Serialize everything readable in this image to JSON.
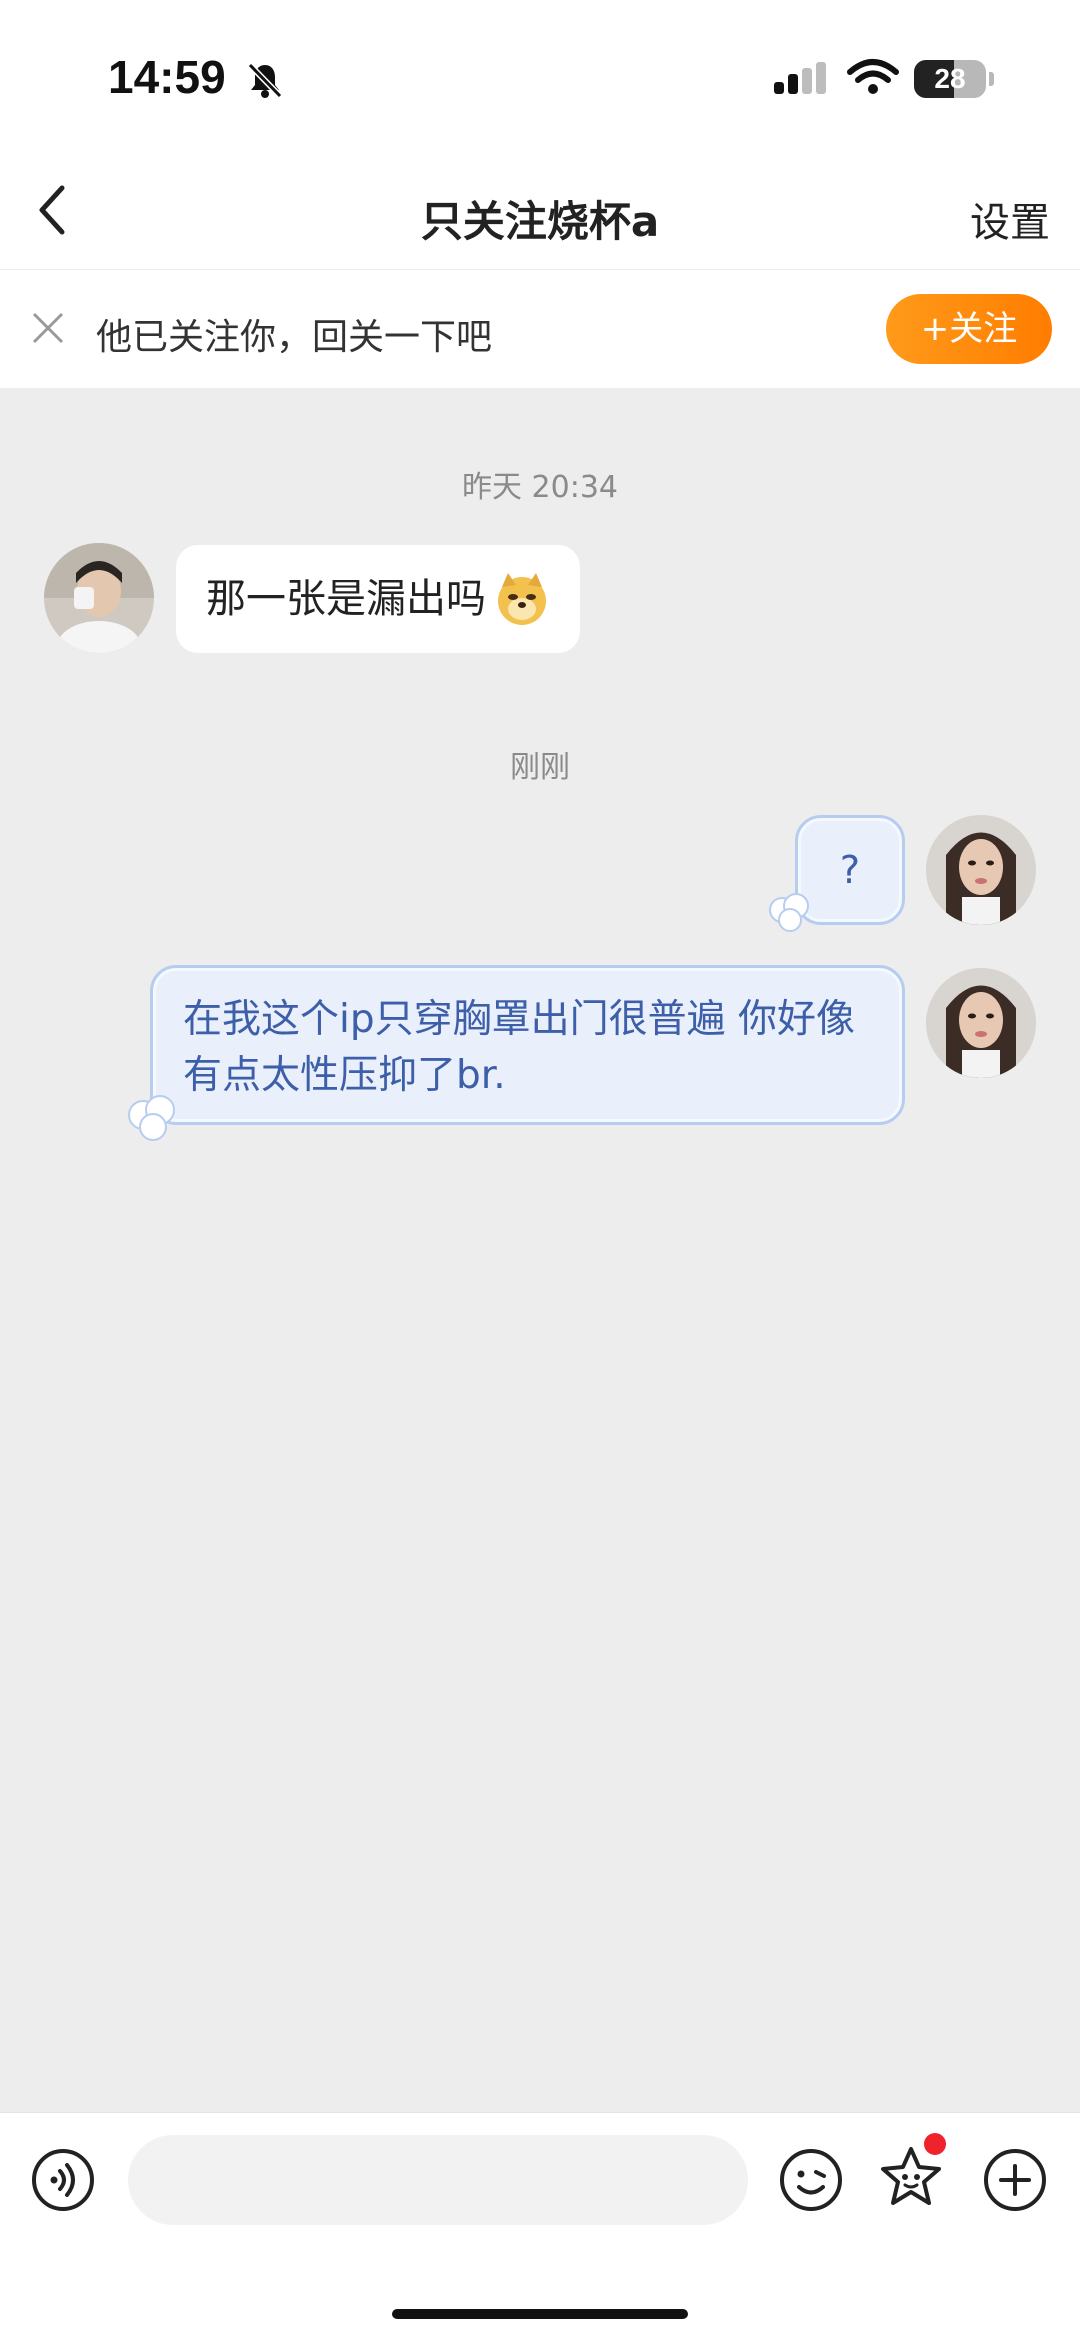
{
  "status_bar": {
    "time": "14:59",
    "battery": "28",
    "icons": [
      "bell-muted-icon",
      "signal-icon",
      "wifi-icon",
      "battery-icon"
    ]
  },
  "nav": {
    "title": "只关注烧杯a",
    "settings_label": "设置",
    "back_icon": "chevron-left-icon"
  },
  "banner": {
    "text": "他已关注你，回关一下吧",
    "follow_label": "+关注",
    "close_icon": "close-icon"
  },
  "messages": [
    {
      "timestamp": "昨天 20:34"
    },
    {
      "side": "left",
      "text": "那一张是漏出吗",
      "emoji": "doge-emoji"
    },
    {
      "timestamp": "刚刚"
    },
    {
      "side": "right",
      "text": "?"
    },
    {
      "side": "right",
      "text": "在我这个ip只穿胸罩出门很普遍 你好像有点太性压抑了br."
    }
  ],
  "input_bar": {
    "icons": [
      "voice-icon",
      "emoji-icon",
      "sticker-icon",
      "plus-icon"
    ],
    "placeholder": ""
  },
  "colors": {
    "accent": "#ff8a00",
    "chat_bg": "#ededed",
    "bubble_right_bg": "#e9f0fb",
    "bubble_right_text": "#3d5ea8"
  }
}
